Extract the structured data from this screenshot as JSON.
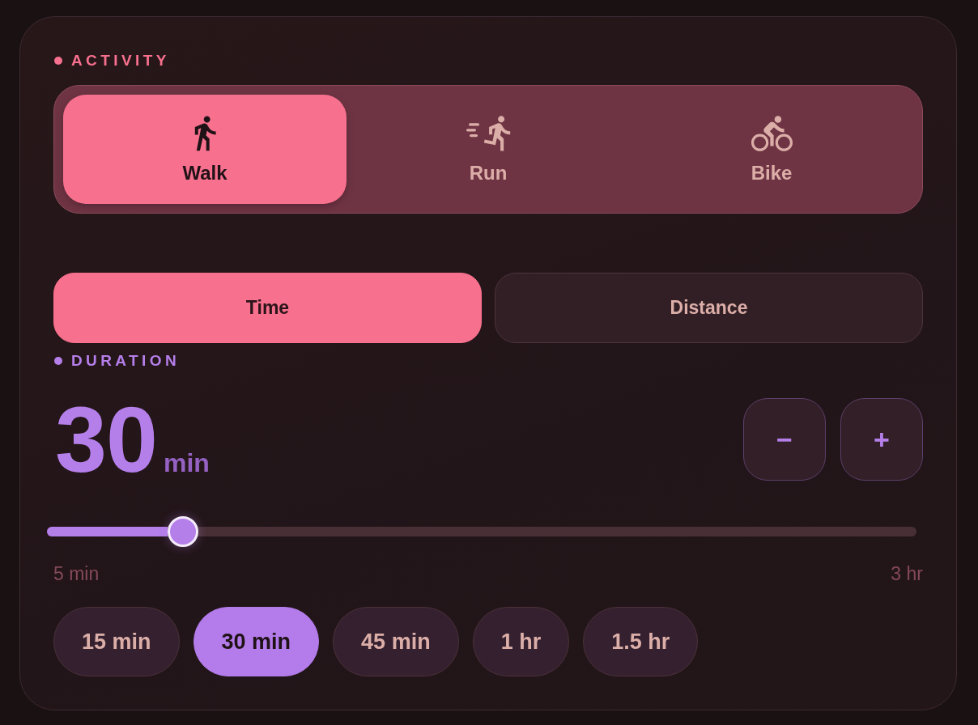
{
  "activity": {
    "label": "ACTIVITY",
    "options": [
      {
        "kind": "walk",
        "label": "Walk",
        "selected": true
      },
      {
        "kind": "run",
        "label": "Run",
        "selected": false
      },
      {
        "kind": "bike",
        "label": "Bike",
        "selected": false
      }
    ]
  },
  "goal_type": [
    {
      "label": "Time",
      "selected": true
    },
    {
      "label": "Distance",
      "selected": false
    }
  ],
  "duration": {
    "label": "DURATION",
    "value": "30",
    "unit": "min",
    "decrease": "−",
    "increase": "+",
    "slider": {
      "level": 0.156,
      "min_label": "5 min",
      "max_label": "3 hr"
    },
    "presets": [
      {
        "label": "15 min",
        "selected": false
      },
      {
        "label": "30 min",
        "selected": true
      },
      {
        "label": "45 min",
        "selected": false
      },
      {
        "label": "1 hr",
        "selected": false
      },
      {
        "label": "1.5 hr",
        "selected": false
      }
    ]
  }
}
